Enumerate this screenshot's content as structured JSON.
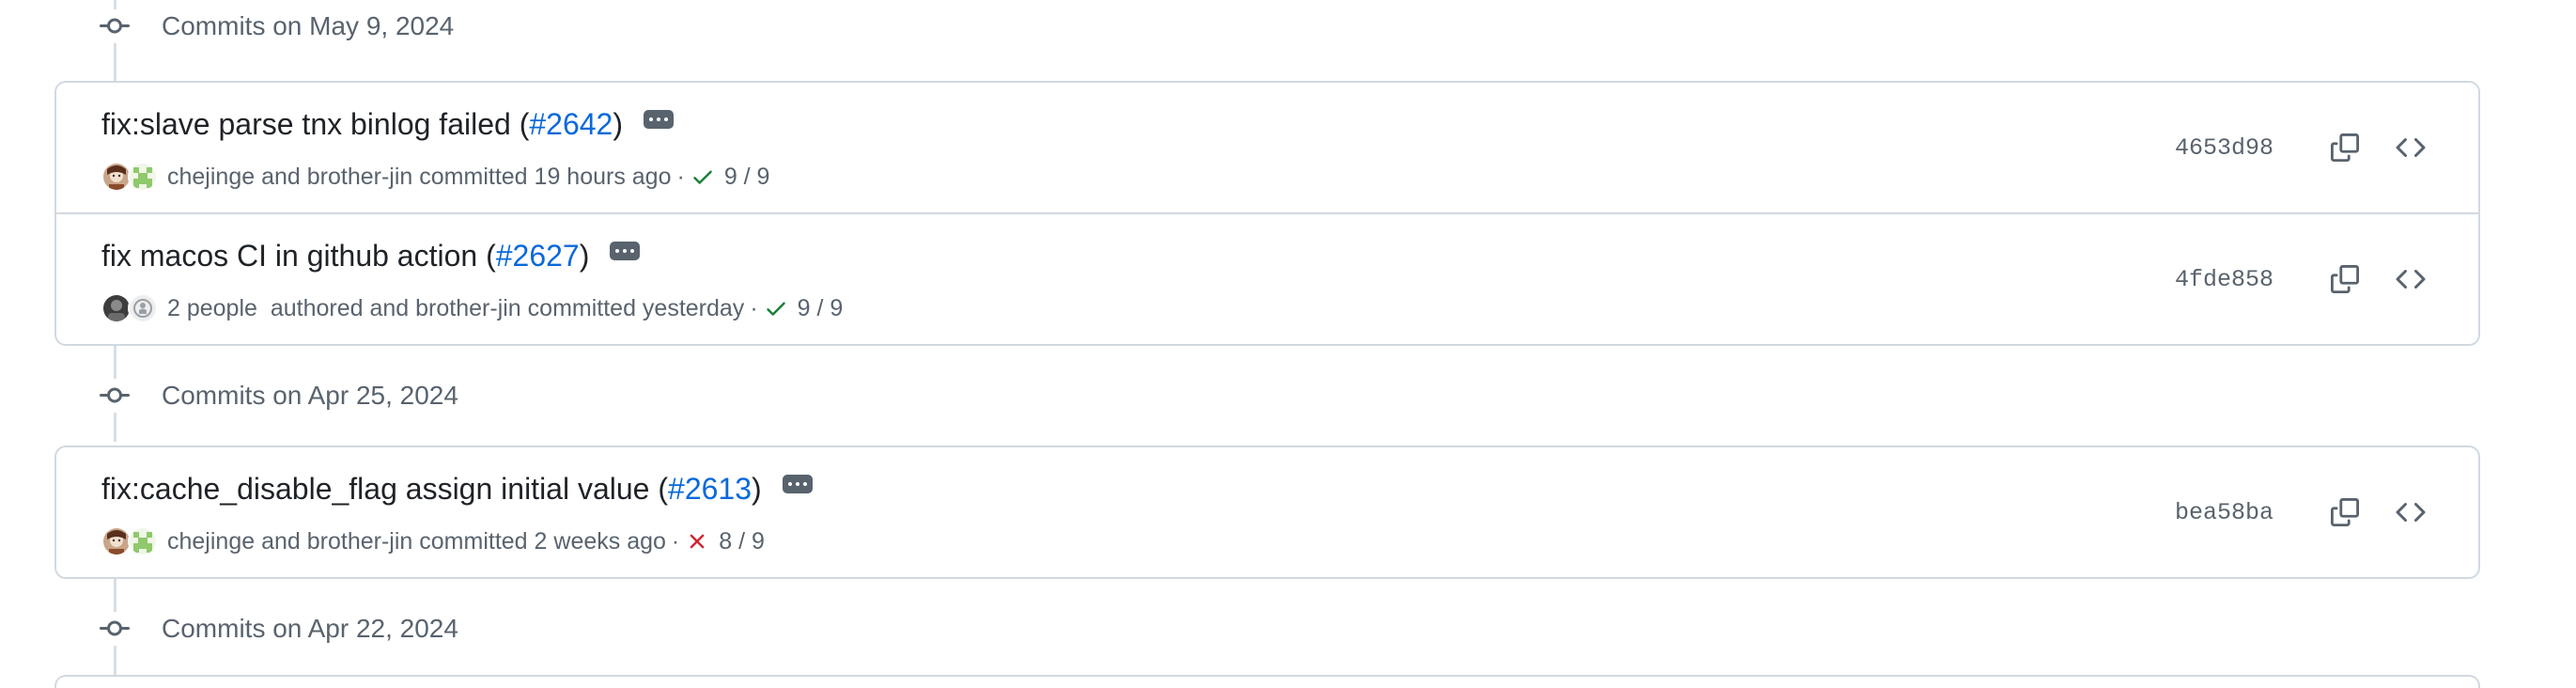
{
  "groups": [
    {
      "title": "Commits on May 9, 2024",
      "commits": [
        {
          "title": "fix:slave parse tnx binlog failed (",
          "pr": "#2642",
          "title_end": ")",
          "author_a": "chejinge",
          "and": "and",
          "author_b": "brother-jin",
          "committed": "committed 19 hours ago",
          "status": "pass",
          "checks": "9 / 9",
          "sha": "4653d98"
        },
        {
          "title": "fix macos CI in github action (",
          "pr": "#2627",
          "title_end": ")",
          "people": "2 people",
          "authored": "authored and",
          "author_b": "brother-jin",
          "committed": "committed yesterday",
          "status": "pass",
          "checks": "9 / 9",
          "sha": "4fde858"
        }
      ]
    },
    {
      "title": "Commits on Apr 25, 2024",
      "commits": [
        {
          "title": "fix:cache_disable_flag assign initial value (",
          "pr": "#2613",
          "title_end": ")",
          "author_a": "chejinge",
          "and": "and",
          "author_b": "brother-jin",
          "committed": "committed 2 weeks ago",
          "status": "fail",
          "checks": "8 / 9",
          "sha": "bea58ba"
        }
      ]
    },
    {
      "title": "Commits on Apr 22, 2024",
      "commits": []
    }
  ],
  "separator": "·",
  "icons": {
    "commit_node": "git-commit-icon",
    "ellipsis": "ellipsis-icon",
    "check": "check-icon",
    "x": "x-icon",
    "copy": "copy-icon",
    "browse": "code-icon"
  },
  "colors": {
    "link": "#0969da",
    "success": "#1a7f37",
    "danger": "#d1242f",
    "muted": "#59636e",
    "border": "#d1d9e0"
  }
}
